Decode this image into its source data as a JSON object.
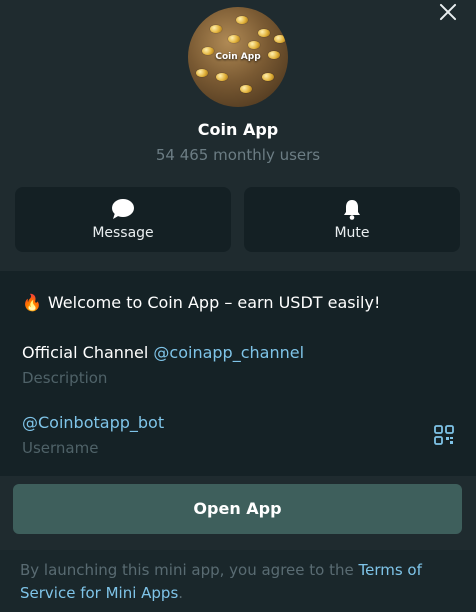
{
  "app": {
    "name": "Coin App",
    "avatar_label": "Coin App",
    "monthly_users": "54 465 monthly users"
  },
  "actions": {
    "message_label": "Message",
    "mute_label": "Mute"
  },
  "info": {
    "welcome_emoji": "🔥",
    "welcome_text": "Welcome to Coin App – earn USDT easily!",
    "channel_prefix": "Official Channel ",
    "channel_link": "@coinapp_channel",
    "channel_caption": "Description",
    "username_value": "@Coinbotapp_bot",
    "username_caption": "Username"
  },
  "open_button": {
    "label": "Open App"
  },
  "footer": {
    "terms_prefix": "By launching this mini app, you agree to the ",
    "terms_link": "Terms of Service for Mini Apps",
    "terms_suffix": "."
  },
  "colors": {
    "background": "#1f2b2f",
    "panel": "#152226",
    "link": "#7fc4e8",
    "primary_button": "#3e5f5c",
    "muted_text": "#6c7d84"
  },
  "icons": [
    "close-icon",
    "message-icon",
    "bell-icon",
    "qr-code-icon",
    "fire-icon"
  ]
}
